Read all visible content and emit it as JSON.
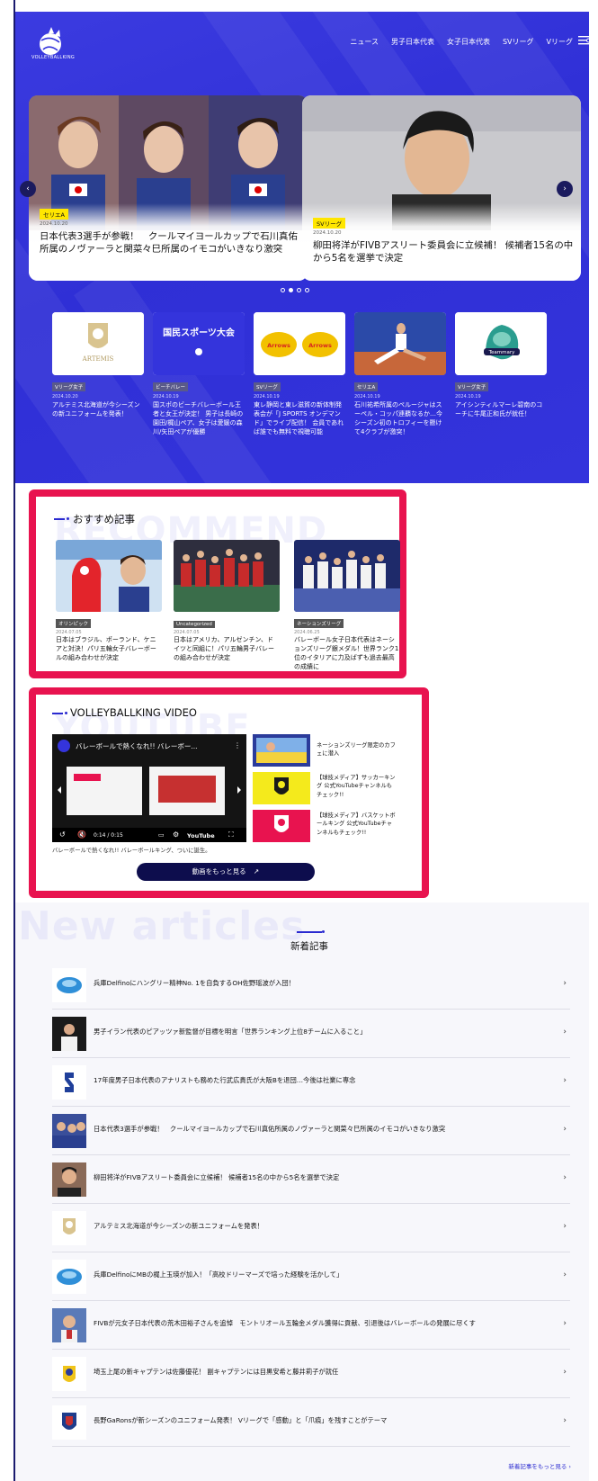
{
  "header": {
    "logo_text": "VOLLEYBALLKING",
    "nav": [
      "ニュース",
      "男子日本代表",
      "女子日本代表",
      "SVリーグ",
      "Vリーグ"
    ]
  },
  "hero": {
    "slides": [
      {
        "tag": "セリエA",
        "date": "2024.10.20",
        "title": "日本代表3選手が参戦！　クールマイヨールカップで石川真佑所属のノヴァーラと関菜々巳所属のイモコがいきなり激突"
      },
      {
        "tag": "SVリーグ",
        "date": "2024.10.20",
        "title": "柳田将洋がFIVBアスリート委員会に立候補！ 候補者15名の中から5名を選挙で決定"
      }
    ],
    "cards": [
      {
        "thumb": "ARTEMIS",
        "tag": "Vリーグ女子",
        "date": "2024.10.20",
        "title": "アルテミス北海道が今シーズンの新ユニフォームを発表！"
      },
      {
        "thumb": "国民スポーツ大会",
        "tag": "ビーチバレー",
        "date": "2024.10.19",
        "title": "国スポのビーチバレーボール王者と女王が決定！ 男子は長崎の園田/梶山ペア、女子は愛媛の森川/矢田ペアが優勝"
      },
      {
        "thumb": "Arrows",
        "tag": "SVリーグ",
        "date": "2024.10.19",
        "title": "東レ静岡と東レ滋賀の新体制発表会が「J SPORTS オンデマンド」でライブ配信！ 会員であれば誰でも無料で視聴可能"
      },
      {
        "thumb": "photo",
        "tag": "セリエA",
        "date": "2024.10.19",
        "title": "石川祐希所属のペルージャはスーペル・コッパ連覇なるか…今シーズン初のトロフィーを懸けて4クラブが激突！"
      },
      {
        "thumb": "Teammary",
        "tag": "Vリーグ女子",
        "date": "2024.10.19",
        "title": "アイシンティルマーレ碧南のコーチに牛尾正和氏が就任！"
      }
    ]
  },
  "recommend": {
    "bg_text": "RECOMMEND",
    "title": "おすすめ記事",
    "items": [
      {
        "tag": "オリンピック",
        "date": "2024.07.05",
        "title": "日本はブラジル、ポーランド、ケニアと対決！パリ五輪女子バレーボールの組み合わせが決定"
      },
      {
        "tag": "Uncategorized",
        "date": "2024.07.05",
        "title": "日本はアメリカ、アルゼンチン、ドイツと同組に！パリ五輪男子バレーの組み合わせが決定"
      },
      {
        "tag": "ネーションズリーグ",
        "date": "2024.06.25",
        "title": "バレーボール女子日本代表はネーションズリーグ銀メダル！世界ランク1位のイタリアに力及ばずも過去最高の成績に"
      }
    ]
  },
  "video": {
    "bg_text": "YOUTUBE",
    "title": "VOLLEYBALLKING VIDEO",
    "player_title": "バレーボールで熱くなれ!! バレーボー...",
    "player_time": "0:14 / 0:15",
    "player_brand": "YouTube",
    "caption": "バレーボールで熱くなれ!! バレーボールキング、ついに誕生。",
    "side_items": [
      "ネーションズリーグ限定のカフェに潜入",
      "【球技メディア】サッカーキング 公式YouTubeチャンネルもチェック!!",
      "【球技メディア】バスケットボールキング 公式YouTubeチャンネルもチェック!!"
    ],
    "more_label": "動画をもっと見る"
  },
  "new_articles": {
    "bg_text": "New articles",
    "title": "新着記事",
    "items": [
      "兵庫Delfinoにハングリー精神No. 1を自負するOH佐野瑶波が入団！",
      "男子イラン代表のピアッツァ新監督が目標を明言「世界ランキング上位8チームに入ること」",
      "17年度男子日本代表のアナリストも務めた行武広貴氏が大阪Bを退団…今後は社業に専念",
      "日本代表3選手が参戦！　クールマイヨールカップで石川真佑所属のノヴァーラと関菜々巳所属のイモコがいきなり激突",
      "柳田将洋がFIVBアスリート委員会に立候補！ 候補者15名の中から5名を選挙で決定",
      "アルテミス北海道が今シーズンの新ユニフォームを発表！",
      "兵庫DelfinoにMBの梶上玉瑛が加入！「高校ドリーマーズで培った経験を活かして」",
      "FIVBが元女子日本代表の荒木田裕子さんを追悼　モントリオール五輪金メダル獲得に貢献、引退後はバレーボールの発展に尽くす",
      "埼玉上尾の新キャプテンは佐藤優花！ 副キャプテンには目黒安希と藤井莉子が就任",
      "長野GaRonsが新シーズンのユニフォーム発表！ Vリーグで「感動」と「爪痕」を残すことがテーマ"
    ],
    "more_label": "新着記事をもっと見る"
  }
}
